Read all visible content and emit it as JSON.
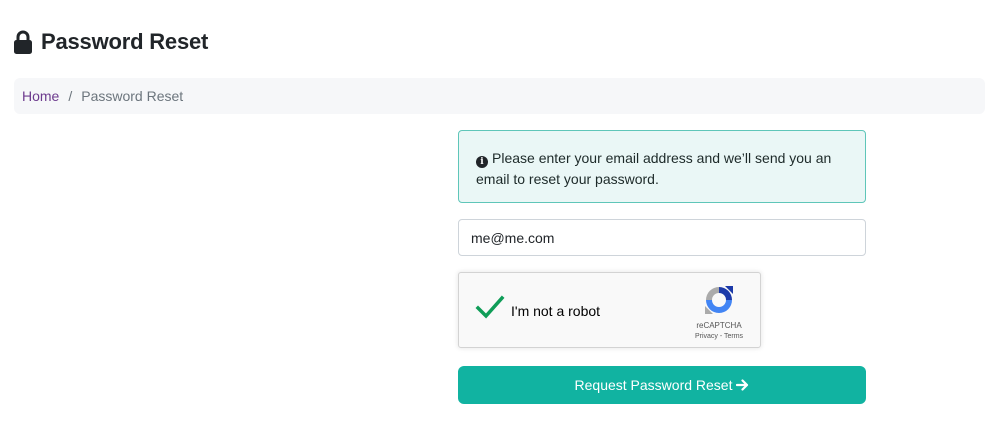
{
  "header": {
    "title": "Password Reset",
    "icon": "lock-icon"
  },
  "breadcrumb": {
    "home": "Home",
    "separator": "/",
    "current": "Password Reset"
  },
  "alert": {
    "icon": "info-icon",
    "icon_glyph": "i",
    "message": "Please enter your email address and we’ll send you an email to reset your password."
  },
  "form": {
    "email_value": "me@me.com",
    "submit_label": "Request Password Reset",
    "submit_icon": "arrow-right-icon"
  },
  "captcha": {
    "label": "I'm not a robot",
    "brand": "reCAPTCHA",
    "privacy": "Privacy",
    "links_separator": " - ",
    "terms": "Terms",
    "checked": true
  },
  "colors": {
    "accent": "#11b3a1",
    "link": "#6d3b8e",
    "alert_bg": "#eaf7f6",
    "alert_border": "#5fc6b9",
    "check": "#0f9d58"
  }
}
